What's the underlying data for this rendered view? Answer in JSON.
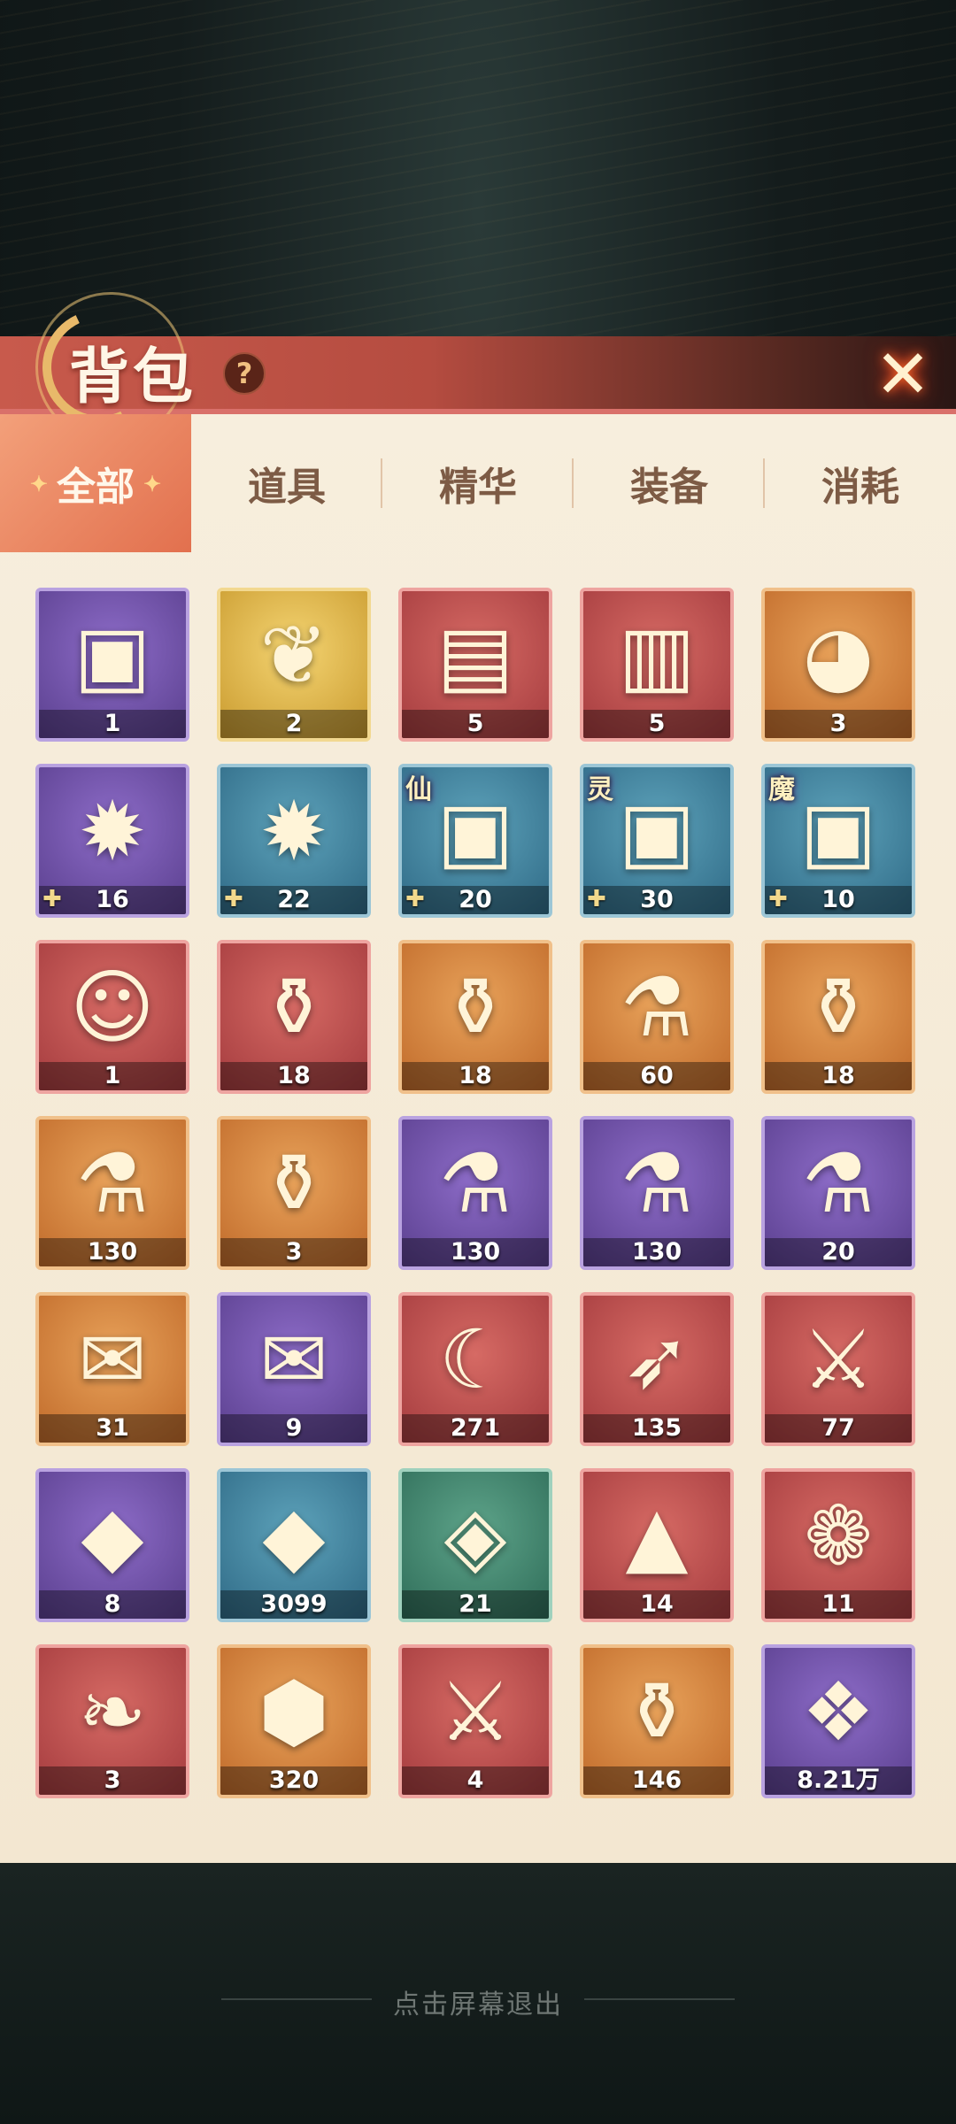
{
  "header": {
    "title": "背包",
    "help_label": "?",
    "close_label": "✕"
  },
  "tabs": [
    {
      "label": "全部",
      "active": true
    },
    {
      "label": "道具",
      "active": false
    },
    {
      "label": "精华",
      "active": false
    },
    {
      "label": "装备",
      "active": false
    },
    {
      "label": "消耗",
      "active": false
    }
  ],
  "items": [
    {
      "icon": "treasure-chest-icon",
      "glyph": "▣",
      "rarity": "purple",
      "count": "1"
    },
    {
      "icon": "wings-icon",
      "glyph": "❦",
      "rarity": "gold",
      "count": "2"
    },
    {
      "icon": "card-pack-icon",
      "glyph": "▤",
      "rarity": "red",
      "count": "5"
    },
    {
      "icon": "card-box-icon",
      "glyph": "▥",
      "rarity": "red",
      "count": "5"
    },
    {
      "icon": "pouch-icon",
      "glyph": "◕",
      "rarity": "orange",
      "count": "3"
    },
    {
      "icon": "purple-flame-icon",
      "glyph": "✹",
      "rarity": "purple",
      "count": "16",
      "fragment": true
    },
    {
      "icon": "blue-flame-icon",
      "glyph": "✹",
      "rarity": "blue",
      "count": "22",
      "fragment": true
    },
    {
      "icon": "immortal-chest-icon",
      "glyph": "▣",
      "rarity": "blue",
      "count": "20",
      "fragment": true,
      "tag": "仙"
    },
    {
      "icon": "spirit-chest-icon",
      "glyph": "▣",
      "rarity": "blue",
      "count": "30",
      "fragment": true,
      "tag": "灵"
    },
    {
      "icon": "demon-chest-icon",
      "glyph": "▣",
      "rarity": "blue",
      "count": "10",
      "fragment": true,
      "tag": "魔"
    },
    {
      "icon": "portrait-card-icon",
      "glyph": "☺",
      "rarity": "red",
      "count": "1"
    },
    {
      "icon": "green-potion-icon",
      "glyph": "⚱",
      "rarity": "red",
      "count": "18"
    },
    {
      "icon": "purple-potion-icon",
      "glyph": "⚱",
      "rarity": "orange",
      "count": "18"
    },
    {
      "icon": "pink-flask-icon",
      "glyph": "⚗",
      "rarity": "orange",
      "count": "60"
    },
    {
      "icon": "gold-potion-icon",
      "glyph": "⚱",
      "rarity": "orange",
      "count": "18"
    },
    {
      "icon": "green-flask-icon",
      "glyph": "⚗",
      "rarity": "orange",
      "count": "130"
    },
    {
      "icon": "red-potion-icon",
      "glyph": "⚱",
      "rarity": "orange",
      "count": "3"
    },
    {
      "icon": "violet-flask-icon",
      "glyph": "⚗",
      "rarity": "purple",
      "count": "130"
    },
    {
      "icon": "amber-flask-icon",
      "glyph": "⚗",
      "rarity": "purple",
      "count": "130"
    },
    {
      "icon": "red-flask-icon",
      "glyph": "⚗",
      "rarity": "purple",
      "count": "20"
    },
    {
      "icon": "gold-scroll-icon",
      "glyph": "✉",
      "rarity": "orange",
      "count": "31"
    },
    {
      "icon": "white-scroll-icon",
      "glyph": "✉",
      "rarity": "purple",
      "count": "9"
    },
    {
      "icon": "moon-staff-icon",
      "glyph": "☾",
      "rarity": "red",
      "count": "271"
    },
    {
      "icon": "spear-icon",
      "glyph": "➶",
      "rarity": "red",
      "count": "135"
    },
    {
      "icon": "dagger-icon",
      "glyph": "⚔",
      "rarity": "red",
      "count": "77"
    },
    {
      "icon": "magma-ore-icon",
      "glyph": "◆",
      "rarity": "purple",
      "count": "8"
    },
    {
      "icon": "stone-ore-icon",
      "glyph": "◆",
      "rarity": "blue",
      "count": "3099"
    },
    {
      "icon": "rune-stone-icon",
      "glyph": "◈",
      "rarity": "green",
      "count": "21"
    },
    {
      "icon": "salt-tray-icon",
      "glyph": "▲",
      "rarity": "red",
      "count": "14"
    },
    {
      "icon": "peach-icon",
      "glyph": "❁",
      "rarity": "red",
      "count": "11"
    },
    {
      "icon": "feather-icon",
      "glyph": "❧",
      "rarity": "red",
      "count": "3"
    },
    {
      "icon": "gold-ingot-icon",
      "glyph": "⬢",
      "rarity": "orange",
      "count": "320"
    },
    {
      "icon": "banner-icon",
      "glyph": "⚔",
      "rarity": "red",
      "count": "4"
    },
    {
      "icon": "jade-vase-icon",
      "glyph": "⚱",
      "rarity": "orange",
      "count": "146"
    },
    {
      "icon": "crystal-leaf-icon",
      "glyph": "❖",
      "rarity": "purple",
      "count": "8.21万"
    }
  ],
  "footer": {
    "exit_hint": "点击屏幕退出"
  }
}
